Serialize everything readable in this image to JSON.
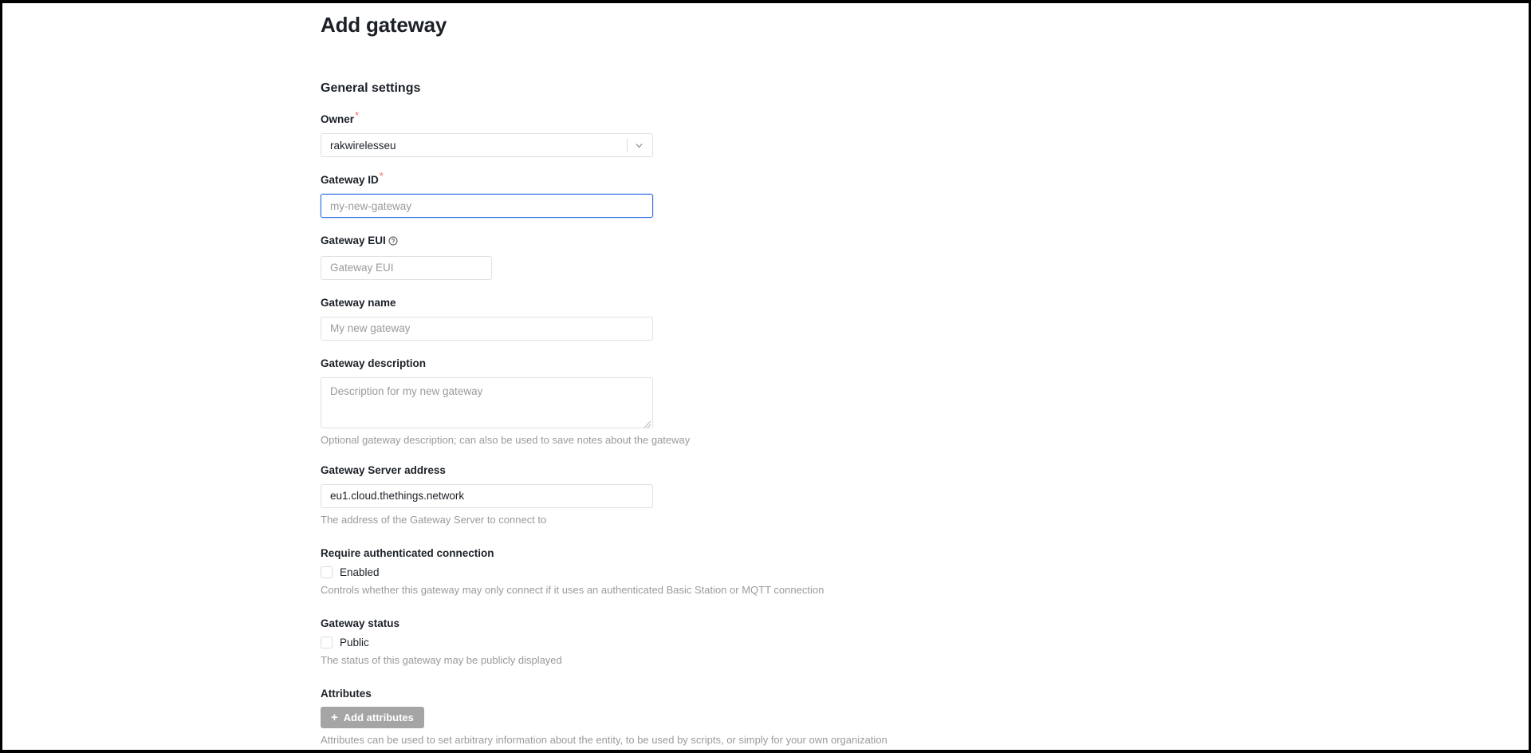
{
  "page": {
    "title": "Add gateway",
    "section_title": "General settings"
  },
  "fields": {
    "owner": {
      "label": "Owner",
      "required_marker": "*",
      "value": "rakwirelesseu",
      "caret_icon": "chevron-down-icon"
    },
    "gateway_id": {
      "label": "Gateway ID",
      "required_marker": "*",
      "value": "",
      "placeholder": "my-new-gateway",
      "focused": true
    },
    "gateway_eui": {
      "label": "Gateway EUI",
      "info_icon": "question-circle-icon",
      "value": "",
      "placeholder": "Gateway EUI"
    },
    "gateway_name": {
      "label": "Gateway name",
      "value": "",
      "placeholder": "My new gateway"
    },
    "gateway_description": {
      "label": "Gateway description",
      "value": "",
      "placeholder": "Description for my new gateway",
      "help": "Optional gateway description; can also be used to save notes about the gateway",
      "resize_icon": "resize-grip-icon"
    },
    "gateway_server_address": {
      "label": "Gateway Server address",
      "value": "eu1.cloud.thethings.network",
      "help": "The address of the Gateway Server to connect to"
    },
    "require_authenticated_connection": {
      "label": "Require authenticated connection",
      "checkbox_label": "Enabled",
      "checked": false,
      "help": "Controls whether this gateway may only connect if it uses an authenticated Basic Station or MQTT connection"
    },
    "gateway_status": {
      "label": "Gateway status",
      "checkbox_label": "Public",
      "checked": false,
      "help": "The status of this gateway may be publicly displayed"
    },
    "attributes": {
      "label": "Attributes",
      "button_label": "Add attributes",
      "button_icon": "plus-icon",
      "help": "Attributes can be used to set arbitrary information about the entity, to be used by scripts, or simply for your own organization"
    }
  },
  "colors": {
    "required_star": "#ef6c6c",
    "focus_border": "#2f6fe4",
    "button_bg": "#a5a5a5",
    "text": "#1c2127",
    "muted_text": "#9a9a9f",
    "input_border": "#e0e0e2"
  }
}
